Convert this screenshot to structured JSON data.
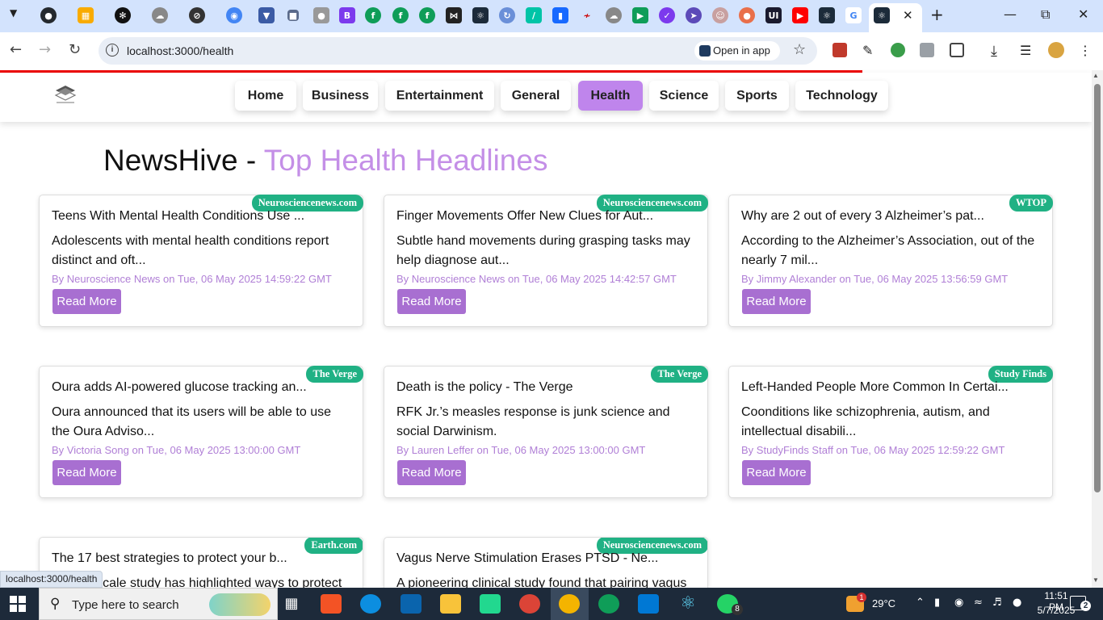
{
  "browser": {
    "url": "localhost:3000/health",
    "open_in_app": "Open in app",
    "status_tooltip": "localhost:3000/health"
  },
  "nav": {
    "items": [
      {
        "label": "Home"
      },
      {
        "label": "Business"
      },
      {
        "label": "Entertainment"
      },
      {
        "label": "General"
      },
      {
        "label": "Health",
        "active": true
      },
      {
        "label": "Science"
      },
      {
        "label": "Sports"
      },
      {
        "label": "Technology"
      }
    ]
  },
  "page": {
    "title_prefix": "NewsHive - ",
    "title_accent": "Top Health Headlines",
    "accent_color": "#c48fe7"
  },
  "cards": [
    {
      "source": "Neurosciencenews.com",
      "title": "Teens With Mental Health Conditions Use ...",
      "description": "Adolescents with mental health conditions report distinct and oft...",
      "meta": "By Neuroscience News on Tue, 06 May 2025 14:59:22 GMT",
      "button": "Read More"
    },
    {
      "source": "Neurosciencenews.com",
      "title": "Finger Movements Offer New Clues for Aut...",
      "description": "Subtle hand movements during grasping tasks may help diagnose aut...",
      "meta": "By Neuroscience News on Tue, 06 May 2025 14:42:57 GMT",
      "button": "Read More"
    },
    {
      "source": "WTOP",
      "title": "Why are 2 out of every 3 Alzheimer’s pat...",
      "description": "According to the Alzheimer’s Association, out of the nearly 7 mil...",
      "meta": "By Jimmy Alexander on Tue, 06 May 2025 13:56:59 GMT",
      "button": "Read More"
    },
    {
      "source": "The Verge",
      "title": "Oura adds AI-powered glucose tracking an...",
      "description": "Oura announced that its users will be able to use the Oura Adviso...",
      "meta": "By Victoria Song on Tue, 06 May 2025 13:00:00 GMT",
      "button": "Read More"
    },
    {
      "source": "The Verge",
      "title": "Death is the policy - The Verge",
      "description": "RFK Jr.’s measles response is junk science and social Darwinism.",
      "meta": "By Lauren Leffer on Tue, 06 May 2025 13:00:00 GMT",
      "button": "Read More"
    },
    {
      "source": "Study Finds",
      "title": "Left-Handed People More Common In Certai...",
      "description": "Coonditions like schizophrenia, autism, and intellectual disabili...",
      "meta": "By StudyFinds Staff on Tue, 06 May 2025 12:59:22 GMT",
      "button": "Read More"
    },
    {
      "source": "Earth.com",
      "title": "The 17 best strategies to protect your b...",
      "description": "A large-scale study has highlighted ways to protect",
      "meta": "",
      "button": ""
    },
    {
      "source": "Neurosciencenews.com",
      "title": "Vagus Nerve Stimulation Erases PTSD - Ne...",
      "description": "A pioneering clinical study found that pairing vagus",
      "meta": "",
      "button": ""
    }
  ],
  "taskbar": {
    "search_placeholder": "Type here to search",
    "temperature": "29°C",
    "time": "11:51 PM",
    "date": "5/7/2025",
    "whatsapp_badge": "8",
    "weather_badge": "1",
    "notification_count": "2"
  },
  "colors": {
    "badge": "#20b184",
    "button": "#a86fd1",
    "nav_active": "#bf85ec",
    "progress": "#ee0000"
  }
}
